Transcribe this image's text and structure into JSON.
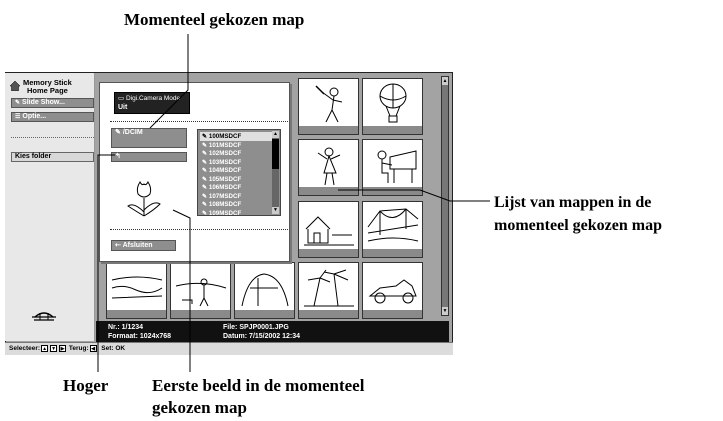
{
  "callouts": {
    "current_folder": "Momenteel gekozen map",
    "folder_list_line1": "Lijst van mappen in de",
    "folder_list_line2": "momenteel gekozen map",
    "up": "Hoger",
    "first_image_line1": "Eerste beeld in de momenteel",
    "first_image_line2": "gekozen map"
  },
  "sidebar": {
    "home_line1": "Memory Stick",
    "home_line2": "Home Page",
    "slideshow": "Slide Show...",
    "options": "Optie...",
    "choose_folder": "Kies folder"
  },
  "popup": {
    "mode_title": "Digi.Camera Mode",
    "mode_value": "Uit",
    "current_folder": "/DCIM",
    "folders": [
      "100MSDCF",
      "101MSDCF",
      "102MSDCF",
      "103MSDCF",
      "104MSDCF",
      "105MSDCF",
      "106MSDCF",
      "107MSDCF",
      "108MSDCF",
      "109MSDCF"
    ],
    "close": "Afsluiten"
  },
  "info": {
    "nr": "Nr.: 1/1234",
    "format": "Formaat: 1024x768",
    "file": "File:  SPJP0001.JPG",
    "date": "Datum:  7/15/2002 12:34"
  },
  "status": {
    "select": "Selecteer:",
    "back": "Terug:",
    "set": "Set: OK"
  },
  "colors": {
    "panel_gray": "#8e8e8e",
    "screen_bg": "#a3a3a3",
    "info_bg": "#111111"
  }
}
